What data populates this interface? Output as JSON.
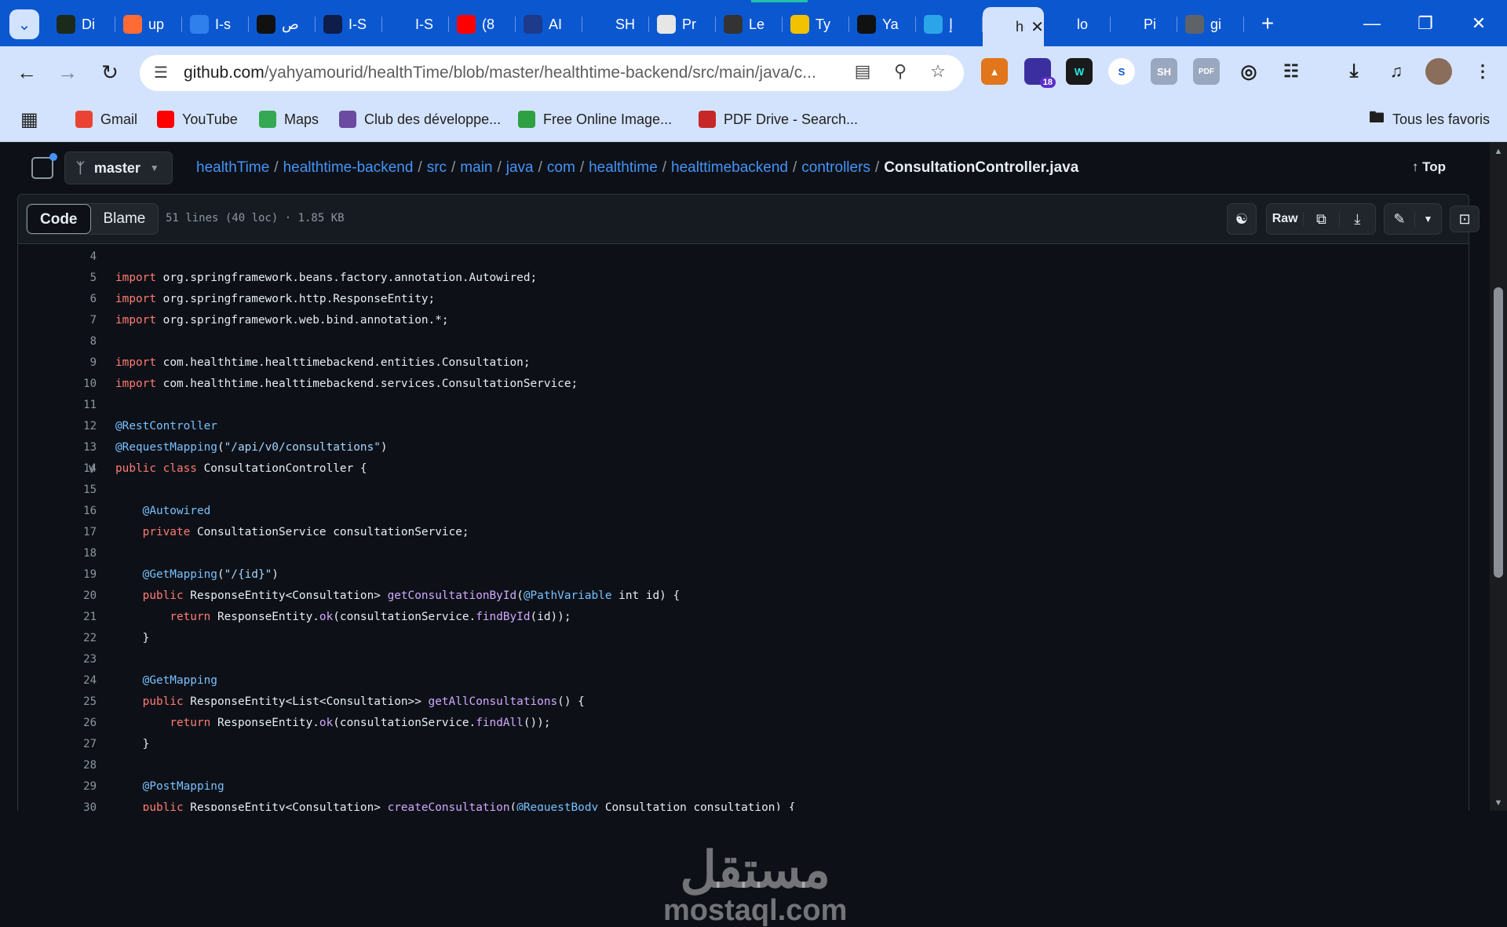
{
  "browser": {
    "tabs": [
      {
        "title": "Di",
        "icon": "dev-icon",
        "color": "#1b2a1b"
      },
      {
        "title": "up",
        "icon": "upwork-icon",
        "color": "#ff6b35"
      },
      {
        "title": "I-s",
        "icon": "flutter-icon",
        "color": "#2f80ed"
      },
      {
        "title": "ص",
        "icon": "openai-icon",
        "color": "#111111"
      },
      {
        "title": "I-S",
        "icon": "bulb-icon",
        "color": "#0e1d4a"
      },
      {
        "title": "I-S",
        "icon": "play-icon",
        "color": "#0b57d0"
      },
      {
        "title": "(8",
        "icon": "youtube-icon",
        "color": "#ff0000"
      },
      {
        "title": "AI",
        "icon": "iq-icon",
        "color": "#1e3a8a"
      },
      {
        "title": "SH",
        "icon": "vuetify-icon",
        "color": "#0b57d0"
      },
      {
        "title": "Pr",
        "icon": "doc-icon",
        "color": "#e6e6e6"
      },
      {
        "title": "Le",
        "icon": "ninja-icon",
        "color": "#333333"
      },
      {
        "title": "Ty",
        "icon": "bee-icon",
        "color": "#f2c200"
      },
      {
        "title": "Ya",
        "icon": "up-icon",
        "color": "#111111"
      },
      {
        "title": "إ",
        "icon": "ring-icon",
        "color": "#2aa6e8"
      },
      {
        "title": "he",
        "icon": "github-icon",
        "color": "#d3e3fd",
        "active": true
      },
      {
        "title": "lo",
        "icon": "tower-icon",
        "color": "#0b57d0"
      },
      {
        "title": "Pi",
        "icon": "pencil-icon",
        "color": "#0b57d0"
      },
      {
        "title": "gi",
        "icon": "globe-icon",
        "color": "#5f6368"
      }
    ],
    "url_host": "github.com",
    "url_path": "/yahyamourid/healthTime/blob/master/healthtime-backend/src/main/java/c...",
    "extension_badge": "18",
    "extensions": [
      "fox-icon",
      "shield-icon",
      "pen-icon",
      "sync-icon",
      "SH",
      "PDF",
      "target-icon",
      "puzzle-icon"
    ],
    "bookmarks": [
      {
        "label": "Gmail",
        "icon": "gmail-icon",
        "color": "#ea4335"
      },
      {
        "label": "YouTube",
        "icon": "youtube-icon",
        "color": "#ff0000"
      },
      {
        "label": "Maps",
        "icon": "maps-icon",
        "color": "#34a853"
      },
      {
        "label": "Club des développe...",
        "icon": "club-icon",
        "color": "#6b4aa1"
      },
      {
        "label": "Free Online Image...",
        "icon": "image-icon",
        "color": "#2ea043"
      },
      {
        "label": "PDF Drive - Search...",
        "icon": "pdf-icon",
        "color": "#c62828"
      }
    ],
    "all_bookmarks": "Tous les favoris"
  },
  "repo": {
    "branch": "master",
    "crumbs": [
      "healthTime",
      "healthtime-backend",
      "src",
      "main",
      "java",
      "com",
      "healthtime",
      "healttimebackend",
      "controllers"
    ],
    "file": "ConsultationController.java",
    "top": "Top"
  },
  "file_header": {
    "code_tab": "Code",
    "blame_tab": "Blame",
    "meta": "51 lines (40 loc) · 1.85 KB",
    "raw": "Raw"
  },
  "code": [
    {
      "n": "4",
      "segs": []
    },
    {
      "n": "5",
      "segs": [
        [
          "kw",
          "import"
        ],
        [
          "",
          "org.springframework.beans.factory.annotation.Autowired;"
        ]
      ]
    },
    {
      "n": "6",
      "segs": [
        [
          "kw",
          "import"
        ],
        [
          "",
          "org.springframework.http.ResponseEntity;"
        ]
      ]
    },
    {
      "n": "7",
      "segs": [
        [
          "kw",
          "import"
        ],
        [
          "",
          "org.springframework.web.bind.annotation.*;"
        ]
      ]
    },
    {
      "n": "8",
      "segs": []
    },
    {
      "n": "9",
      "segs": [
        [
          "kw",
          "import"
        ],
        [
          "",
          "com.healthtime.healttimebackend.entities.Consultation;"
        ]
      ]
    },
    {
      "n": "10",
      "segs": [
        [
          "kw",
          "import"
        ],
        [
          "",
          "com.healthtime.healttimebackend.services.ConsultationService;"
        ]
      ]
    },
    {
      "n": "11",
      "segs": []
    },
    {
      "n": "12",
      "segs": [
        [
          "an",
          "@RestController"
        ]
      ]
    },
    {
      "n": "13",
      "segs": [
        [
          "an",
          "@RequestMapping"
        ],
        [
          "",
          "("
        ],
        [
          "st",
          "\"/api/v0/consultations\""
        ],
        [
          "",
          ")"
        ]
      ]
    },
    {
      "n": "14",
      "segs": [
        [
          "kw",
          "public class"
        ],
        [
          "",
          " ConsultationController {"
        ]
      ],
      "fold": true
    },
    {
      "n": "15",
      "segs": []
    },
    {
      "n": "16",
      "segs": [
        [
          "",
          "    "
        ],
        [
          "an",
          "@Autowired"
        ]
      ]
    },
    {
      "n": "17",
      "segs": [
        [
          "",
          "    "
        ],
        [
          "kw",
          "private"
        ],
        [
          "",
          " ConsultationService consultationService;"
        ]
      ]
    },
    {
      "n": "18",
      "segs": []
    },
    {
      "n": "19",
      "segs": [
        [
          "",
          "    "
        ],
        [
          "an",
          "@GetMapping"
        ],
        [
          "",
          "("
        ],
        [
          "st",
          "\"/{id}\""
        ],
        [
          "",
          ")"
        ]
      ]
    },
    {
      "n": "20",
      "segs": [
        [
          "",
          "    "
        ],
        [
          "kw",
          "public"
        ],
        [
          "",
          " ResponseEntity<Consultation> "
        ],
        [
          "fn",
          "getConsultationById"
        ],
        [
          "",
          "("
        ],
        [
          "an",
          "@PathVariable"
        ],
        [
          "",
          " int id) {"
        ]
      ]
    },
    {
      "n": "21",
      "segs": [
        [
          "",
          "        "
        ],
        [
          "kw",
          "return"
        ],
        [
          "",
          " ResponseEntity."
        ],
        [
          "fn",
          "ok"
        ],
        [
          "",
          "(consultationService."
        ],
        [
          "fn",
          "findById"
        ],
        [
          "",
          "(id));"
        ]
      ]
    },
    {
      "n": "22",
      "segs": [
        [
          "",
          "    }"
        ]
      ]
    },
    {
      "n": "23",
      "segs": []
    },
    {
      "n": "24",
      "segs": [
        [
          "",
          "    "
        ],
        [
          "an",
          "@GetMapping"
        ]
      ]
    },
    {
      "n": "25",
      "segs": [
        [
          "",
          "    "
        ],
        [
          "kw",
          "public"
        ],
        [
          "",
          " ResponseEntity<List<Consultation>> "
        ],
        [
          "fn",
          "getAllConsultations"
        ],
        [
          "",
          "() {"
        ]
      ]
    },
    {
      "n": "26",
      "segs": [
        [
          "",
          "        "
        ],
        [
          "kw",
          "return"
        ],
        [
          "",
          " ResponseEntity."
        ],
        [
          "fn",
          "ok"
        ],
        [
          "",
          "(consultationService."
        ],
        [
          "fn",
          "findAll"
        ],
        [
          "",
          "());"
        ]
      ]
    },
    {
      "n": "27",
      "segs": [
        [
          "",
          "    }"
        ]
      ]
    },
    {
      "n": "28",
      "segs": []
    },
    {
      "n": "29",
      "segs": [
        [
          "",
          "    "
        ],
        [
          "an",
          "@PostMapping"
        ]
      ]
    },
    {
      "n": "30",
      "segs": [
        [
          "",
          "    "
        ],
        [
          "kw",
          "public"
        ],
        [
          "",
          " ResponseEntity<Consultation> "
        ],
        [
          "fn",
          "createConsultation"
        ],
        [
          "",
          "("
        ],
        [
          "an",
          "@RequestBody"
        ],
        [
          "",
          " Consultation consultation) {"
        ]
      ]
    }
  ],
  "watermark": {
    "arabic": "مستقل",
    "latin": "mostaql.com"
  }
}
